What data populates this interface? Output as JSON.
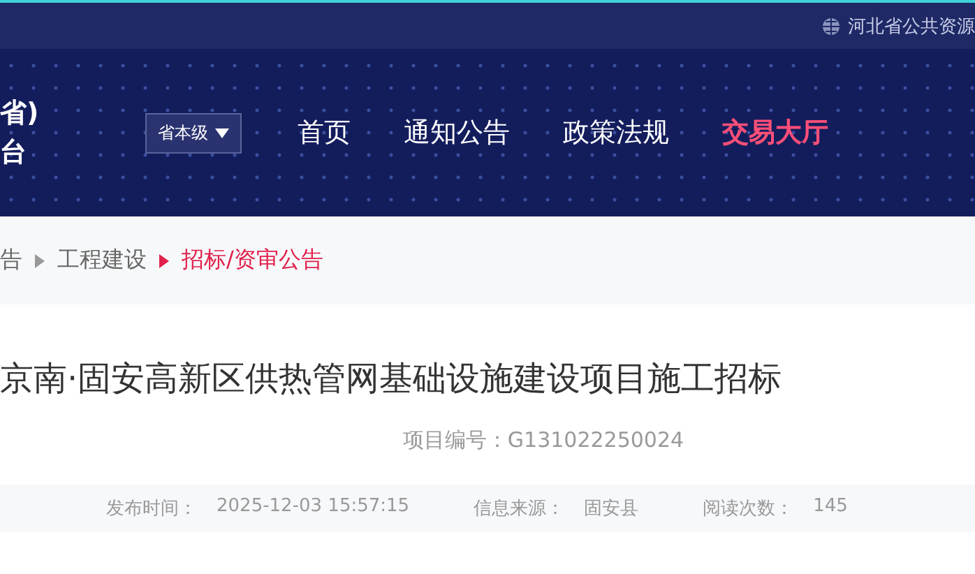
{
  "top_bar": {
    "site_name": "河北省公共资源"
  },
  "header": {
    "logo_lines": [
      "省)",
      "台"
    ],
    "level_select": {
      "value": "省本级"
    },
    "nav": [
      {
        "label": "首页",
        "selected": false
      },
      {
        "label": "通知公告",
        "selected": false
      },
      {
        "label": "政策法规",
        "selected": false
      },
      {
        "label": "交易大厅",
        "selected": true
      }
    ]
  },
  "breadcrumb": [
    {
      "label": "告",
      "current": false
    },
    {
      "label": "工程建设",
      "current": false
    },
    {
      "label": "招标/资审公告",
      "current": true
    }
  ],
  "article": {
    "title": "京南·固安高新区供热管网基础设施建设项目施工招标",
    "project_number": "项目编号：G131022250024",
    "meta": [
      {
        "label": "发布时间：",
        "value": "2025-12-03 15:57:15"
      },
      {
        "label": "信息来源：",
        "value": "固安县"
      },
      {
        "label": "阅读次数：",
        "value": "145"
      }
    ]
  }
}
